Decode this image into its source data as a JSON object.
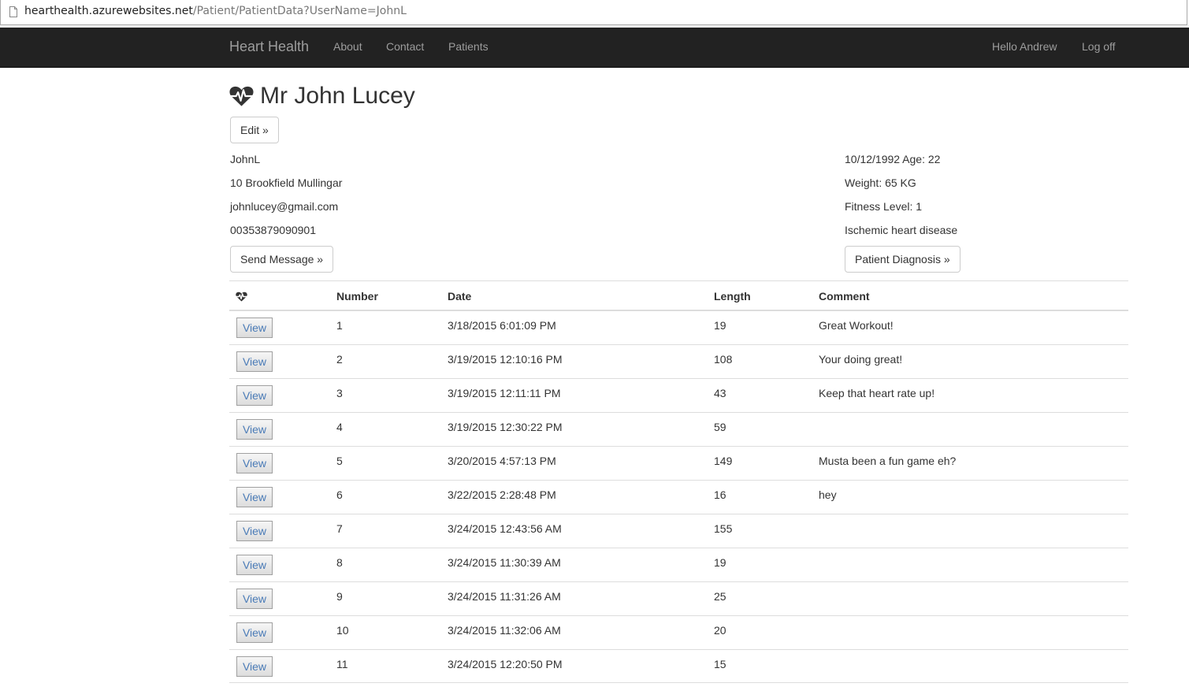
{
  "browser": {
    "url_host": "hearthealth.azurewebsites.net",
    "url_path": "/Patient/PatientData?UserName=JohnL"
  },
  "navbar": {
    "brand": "Heart Health",
    "links": [
      "About",
      "Contact",
      "Patients"
    ],
    "greeting": "Hello Andrew",
    "logoff": "Log off"
  },
  "patient": {
    "title": "Mr John Lucey",
    "edit_label": "Edit »",
    "username": "JohnL",
    "address": "10 Brookfield Mullingar",
    "email": "johnlucey@gmail.com",
    "phone": "00353879090901",
    "send_message_label": "Send Message »",
    "dob_age": "10/12/1992 Age: 22",
    "weight": "Weight: 65 KG",
    "fitness": "Fitness Level: 1",
    "condition": "Ischemic heart disease",
    "diagnosis_label": "Patient Diagnosis »"
  },
  "table": {
    "headers": {
      "number": "Number",
      "date": "Date",
      "length": "Length",
      "comment": "Comment"
    },
    "view_label": "View",
    "rows": [
      {
        "number": "1",
        "date": "3/18/2015 6:01:09 PM",
        "length": "19",
        "comment": "Great Workout!"
      },
      {
        "number": "2",
        "date": "3/19/2015 12:10:16 PM",
        "length": "108",
        "comment": "Your doing great!"
      },
      {
        "number": "3",
        "date": "3/19/2015 12:11:11 PM",
        "length": "43",
        "comment": "Keep that heart rate up!"
      },
      {
        "number": "4",
        "date": "3/19/2015 12:30:22 PM",
        "length": "59",
        "comment": ""
      },
      {
        "number": "5",
        "date": "3/20/2015 4:57:13 PM",
        "length": "149",
        "comment": "Musta been a fun game eh?"
      },
      {
        "number": "6",
        "date": "3/22/2015 2:28:48 PM",
        "length": "16",
        "comment": "hey"
      },
      {
        "number": "7",
        "date": "3/24/2015 12:43:56 AM",
        "length": "155",
        "comment": ""
      },
      {
        "number": "8",
        "date": "3/24/2015 11:30:39 AM",
        "length": "19",
        "comment": ""
      },
      {
        "number": "9",
        "date": "3/24/2015 11:31:26 AM",
        "length": "25",
        "comment": ""
      },
      {
        "number": "10",
        "date": "3/24/2015 11:32:06 AM",
        "length": "20",
        "comment": ""
      },
      {
        "number": "11",
        "date": "3/24/2015 12:20:50 PM",
        "length": "15",
        "comment": ""
      }
    ]
  },
  "colors": {
    "navbar_bg": "#222222",
    "nav_text": "#9d9d9d",
    "link_blue": "#4a7bb7"
  },
  "icons": {
    "page": "page-icon",
    "heart": "heartbeat-icon"
  }
}
